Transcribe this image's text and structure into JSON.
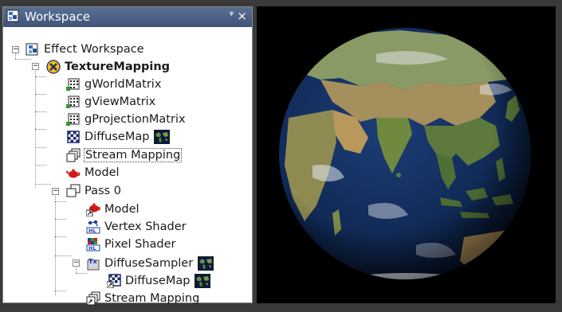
{
  "workspace": {
    "title": "Workspace",
    "pin_icon": "ᵠ",
    "close_icon": "×",
    "tree": {
      "root": "Effect Workspace",
      "effect": "TextureMapping",
      "items": {
        "world": "gWorldMatrix",
        "view": "gViewMatrix",
        "projection": "gProjectionMatrix",
        "diffuse_map": "DiffuseMap",
        "stream_mapping": "Stream Mapping",
        "model": "Model",
        "pass": "Pass 0",
        "pass_model": "Model",
        "vertex_shader": "Vertex Shader",
        "pixel_shader": "Pixel Shader",
        "sampler": "DiffuseSampler",
        "sampler_map": "DiffuseMap",
        "pass_stream_mapping": "Stream Mapping"
      }
    }
  },
  "viewport": {
    "content": "earth-globe",
    "background": "#000000"
  },
  "colors": {
    "title_bar": "#4a5f84",
    "ocean": "#14305e",
    "land": "#5d7a3c"
  }
}
